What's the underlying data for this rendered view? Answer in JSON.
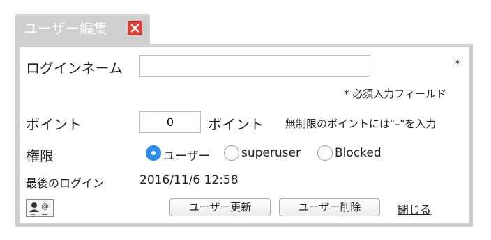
{
  "dialog": {
    "title": "ユーザー編集"
  },
  "form": {
    "login_name_label": "ログインネーム",
    "login_name_value": "",
    "required_mark": "*",
    "required_note": "* 必須入力フィールド",
    "points_label": "ポイント",
    "points_value": "0",
    "points_unit": "ポイント",
    "points_hint": "無制限のポイントには\"–\"を入力",
    "role_label": "権限",
    "roles": [
      {
        "label": "ユーザー",
        "selected": true
      },
      {
        "label": "superuser",
        "selected": false
      },
      {
        "label": "Blocked",
        "selected": false
      }
    ],
    "last_login_label": "最後のログイン",
    "last_login_value": "2016/11/6 12:58"
  },
  "footer": {
    "contact_icon": "user-contact-icon",
    "update_button": "ユーザー更新",
    "delete_button": "ユーザー削除",
    "close_link": "閉じる"
  },
  "colors": {
    "frame": "#cfcfcf",
    "close_button": "#d9403a",
    "radio_selected": "#2f8fe8"
  }
}
